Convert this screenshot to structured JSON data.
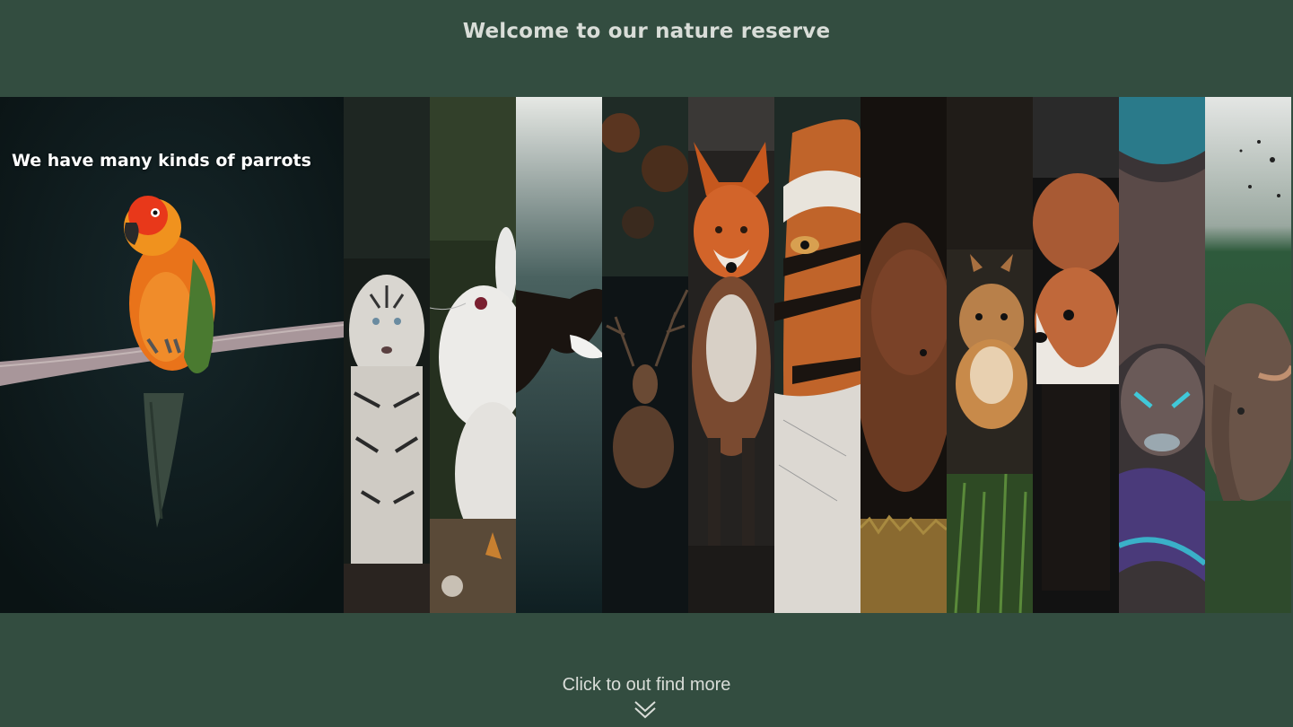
{
  "header": {
    "title": "Welcome to our nature reserve"
  },
  "gallery": {
    "active_caption": "We have many kinds of parrots",
    "panels": [
      {
        "animal": "parrot",
        "icon": "parrot-photo",
        "bg": "#0e1a1a"
      },
      {
        "animal": "white-tiger",
        "icon": "white-tiger-photo",
        "bg": "#1a1f1c"
      },
      {
        "animal": "rabbit",
        "icon": "rabbit-photo",
        "bg": "#2b3526"
      },
      {
        "animal": "eagle",
        "icon": "eagle-photo",
        "bg": "#1d2e30"
      },
      {
        "animal": "deer",
        "icon": "deer-photo",
        "bg": "#141a1c"
      },
      {
        "animal": "fox",
        "icon": "fox-photo",
        "bg": "#2a2624"
      },
      {
        "animal": "tiger",
        "icon": "tiger-photo",
        "bg": "#1f2a26"
      },
      {
        "animal": "bear",
        "icon": "bear-photo",
        "bg": "#1c1612"
      },
      {
        "animal": "squirrel",
        "icon": "squirrel-photo",
        "bg": "#2a2a20"
      },
      {
        "animal": "red-panda",
        "icon": "red-panda-photo",
        "bg": "#1a1a1a"
      },
      {
        "animal": "snake",
        "icon": "snake-photo",
        "bg": "#3a3638"
      },
      {
        "animal": "elephant",
        "icon": "elephant-photo",
        "bg": "#2f4a38"
      }
    ]
  },
  "footer": {
    "cta_label": "Click to out find more",
    "chevron_icon": "double-chevron-down-icon"
  }
}
